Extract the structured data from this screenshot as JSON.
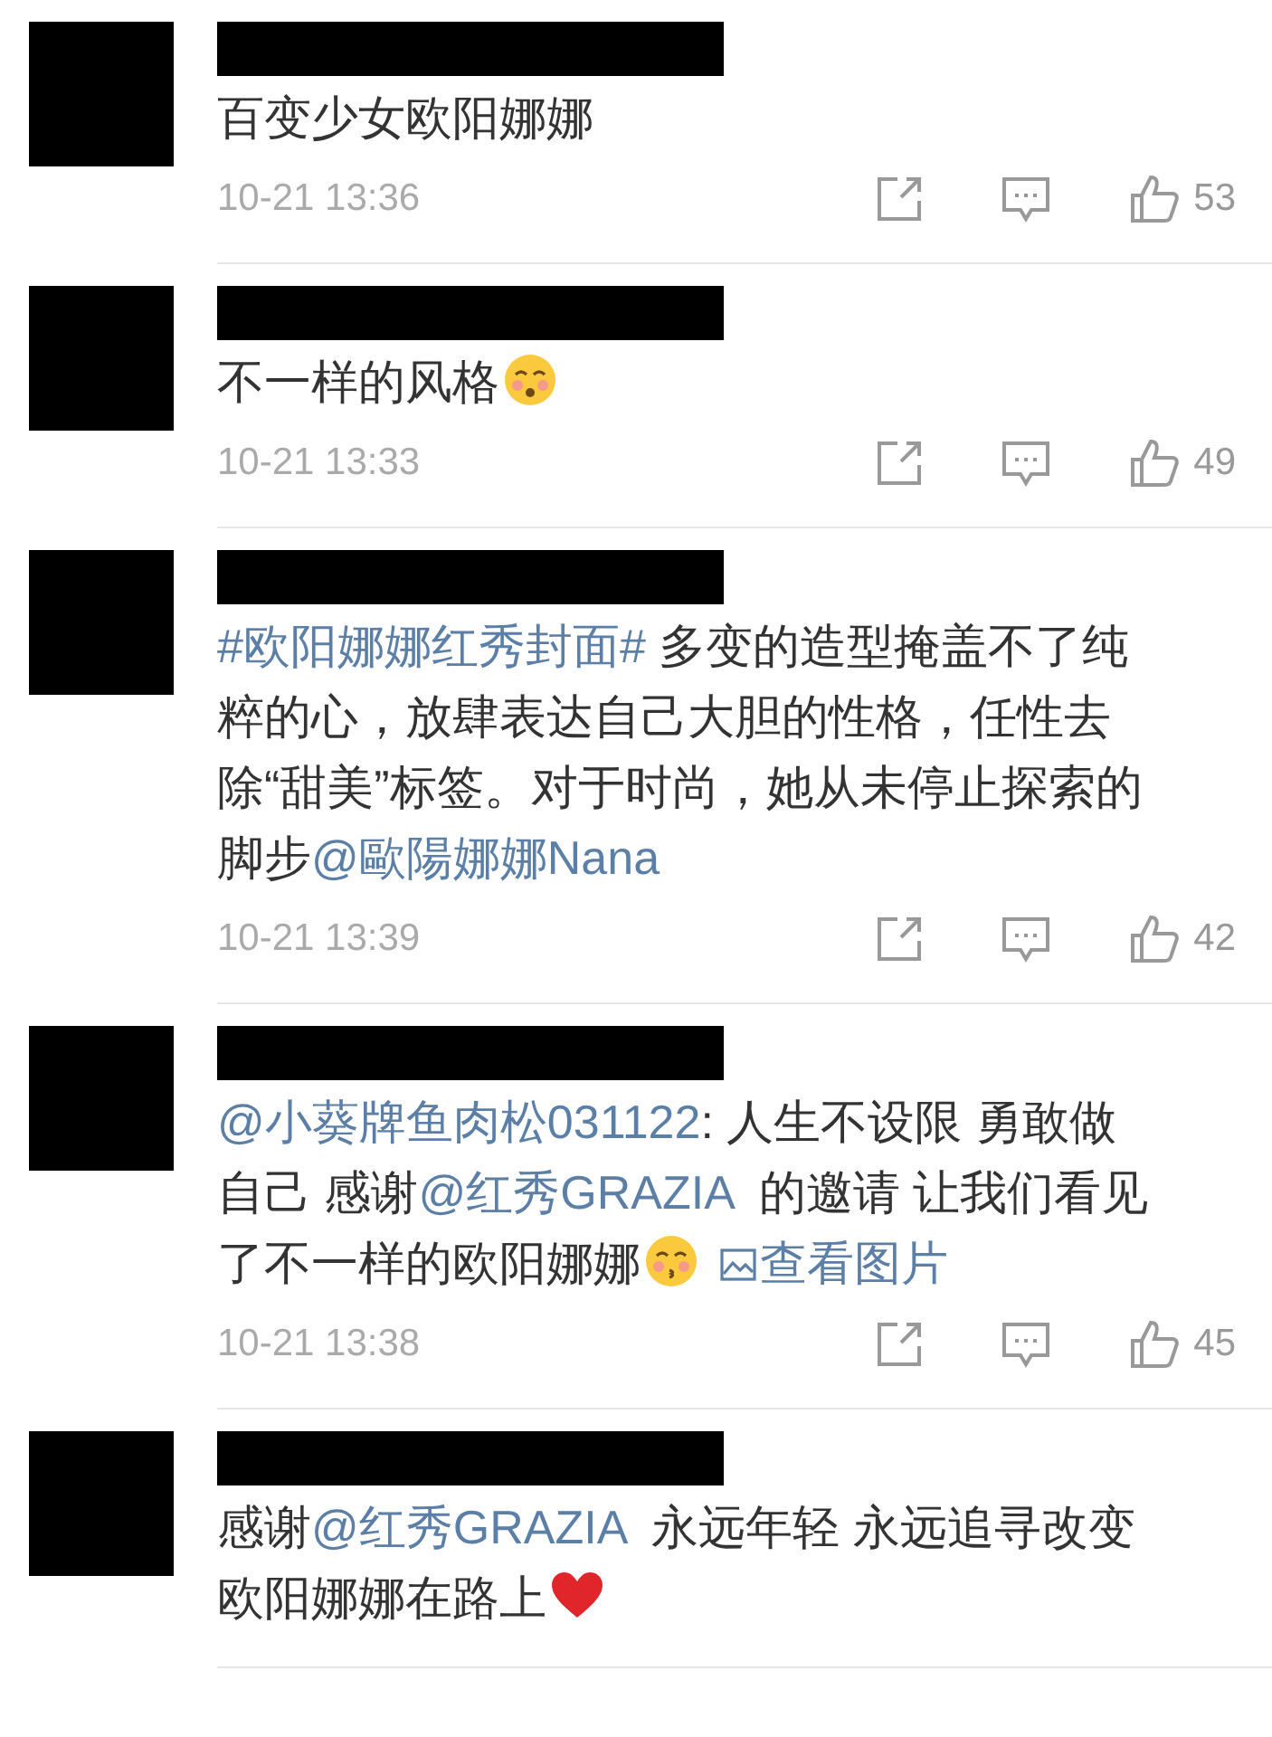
{
  "comments": [
    {
      "body": [
        {
          "kind": "text",
          "text": "百变少女欧阳娜娜"
        }
      ],
      "time": "10-21 13:36",
      "likes": "53"
    },
    {
      "body": [
        {
          "kind": "text",
          "text": "不一样的风格"
        },
        {
          "kind": "blush"
        }
      ],
      "time": "10-21 13:33",
      "likes": "49"
    },
    {
      "body": [
        {
          "kind": "link",
          "text": "#欧阳娜娜红秀封面#"
        },
        {
          "kind": "text",
          "text": " 多变的造型掩盖不了纯粹的心，放肆表达自己大胆的性格，任性去除“甜美”标签。对于时尚，她从未停止探索的脚步"
        },
        {
          "kind": "link",
          "text": "@歐陽娜娜Nana"
        }
      ],
      "time": "10-21 13:39",
      "likes": "42"
    },
    {
      "body": [
        {
          "kind": "link",
          "text": "@小葵牌鱼肉松031122"
        },
        {
          "kind": "text",
          "text": ": 人生不设限 勇敢做自己 感谢"
        },
        {
          "kind": "link",
          "text": "@红秀GRAZIA"
        },
        {
          "kind": "text",
          "text": "  的邀请 让我们看见了不一样的欧阳娜娜"
        },
        {
          "kind": "kiss"
        },
        {
          "kind": "image_link",
          "text": "查看图片"
        }
      ],
      "time": "10-21 13:38",
      "likes": "45"
    },
    {
      "body": [
        {
          "kind": "text",
          "text": "感谢"
        },
        {
          "kind": "link",
          "text": "@红秀GRAZIA"
        },
        {
          "kind": "text",
          "text": "  永远年轻 永远追寻改变欧阳娜娜在路上"
        },
        {
          "kind": "heart"
        }
      ]
    }
  ]
}
